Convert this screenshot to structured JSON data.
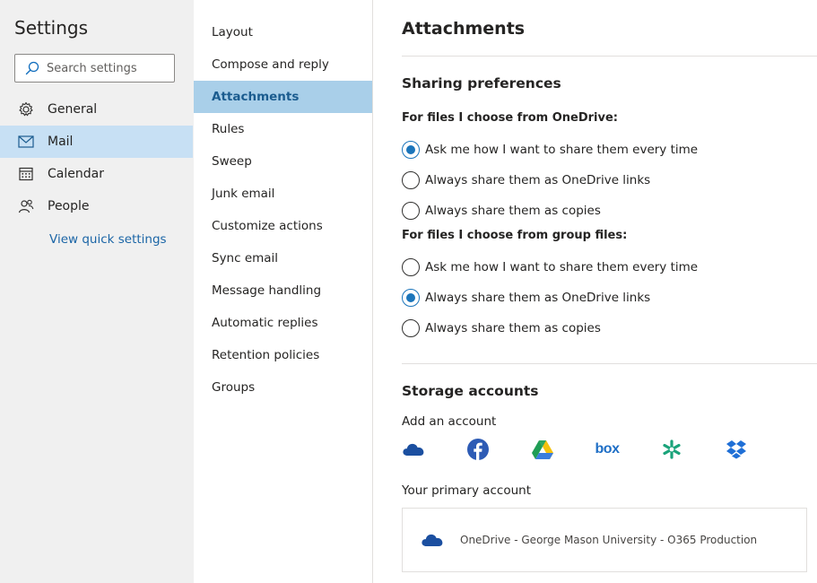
{
  "left_nav": {
    "title": "Settings",
    "search_placeholder": "Search settings",
    "items": [
      {
        "label": "General",
        "icon": "gear-icon"
      },
      {
        "label": "Mail",
        "icon": "mail-icon"
      },
      {
        "label": "Calendar",
        "icon": "calendar-icon"
      },
      {
        "label": "People",
        "icon": "people-icon"
      }
    ],
    "selected": "Mail",
    "quick_settings_link": "View quick settings"
  },
  "mid_nav": {
    "items": [
      {
        "label": "Layout"
      },
      {
        "label": "Compose and reply"
      },
      {
        "label": "Attachments"
      },
      {
        "label": "Rules"
      },
      {
        "label": "Sweep"
      },
      {
        "label": "Junk email"
      },
      {
        "label": "Customize actions"
      },
      {
        "label": "Sync email"
      },
      {
        "label": "Message handling"
      },
      {
        "label": "Automatic replies"
      },
      {
        "label": "Retention policies"
      },
      {
        "label": "Groups"
      }
    ],
    "selected": "Attachments"
  },
  "content": {
    "title": "Attachments",
    "sharing": {
      "title": "Sharing preferences",
      "onedrive_group": {
        "label": "For files I choose from OneDrive:",
        "options": [
          {
            "label": "Ask me how I want to share them every time",
            "checked": true
          },
          {
            "label": "Always share them as OneDrive links",
            "checked": false
          },
          {
            "label": "Always share them as copies",
            "checked": false
          }
        ]
      },
      "group_files_group": {
        "label": "For files I choose from group files:",
        "options": [
          {
            "label": "Ask me how I want to share them every time",
            "checked": false
          },
          {
            "label": "Always share them as OneDrive links",
            "checked": true
          },
          {
            "label": "Always share them as copies",
            "checked": false
          }
        ]
      }
    },
    "storage": {
      "title": "Storage accounts",
      "add_account_label": "Add an account",
      "providers": [
        "onedrive-icon",
        "facebook-icon",
        "google-drive-icon",
        "box-icon",
        "egnyte-icon",
        "dropbox-icon"
      ],
      "box_logo_text": "box",
      "primary_label": "Your primary account",
      "primary_account": "OneDrive - George Mason University - O365 Production"
    }
  },
  "colors": {
    "accent": "#1b75bb",
    "left_selected": "#c7e0f4",
    "mid_selected": "#a9cfe9",
    "link": "#1b65a6"
  }
}
